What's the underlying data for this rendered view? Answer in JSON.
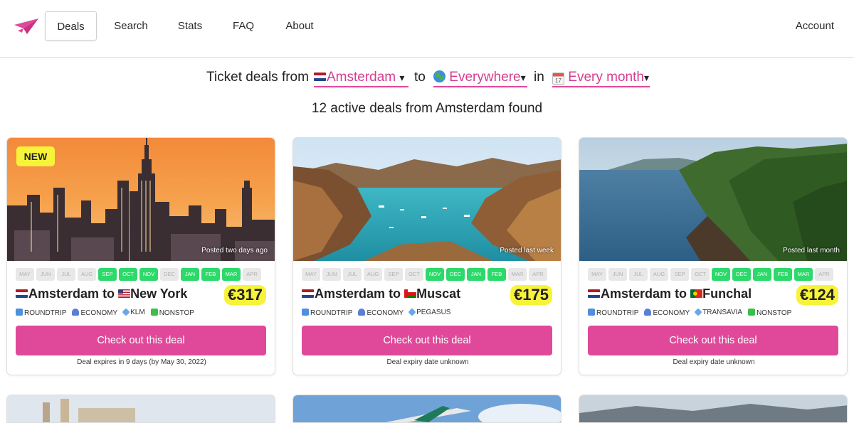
{
  "nav": {
    "items": [
      "Deals",
      "Search",
      "Stats",
      "FAQ",
      "About"
    ],
    "account": "Account"
  },
  "filters": {
    "prefix": "Ticket deals from",
    "from": "Amsterdam",
    "to_word": "to",
    "to": "Everywhere",
    "in_word": "in",
    "when": "Every month",
    "caret": "▾",
    "calendar_day": "17"
  },
  "results": {
    "summary": "12 active deals from Amsterdam found"
  },
  "month_labels": [
    "MAY",
    "JUN",
    "JUL",
    "AUG",
    "SEP",
    "OCT",
    "NOV",
    "DEC",
    "JAN",
    "FEB",
    "MAR",
    "APR"
  ],
  "deals": [
    {
      "badge": "NEW",
      "posted": "Posted two days ago",
      "from": "Amsterdam",
      "to_word": "to",
      "to": "New York",
      "price": "€317",
      "active_months": [
        false,
        false,
        false,
        false,
        true,
        true,
        true,
        false,
        true,
        true,
        true,
        false
      ],
      "tags": [
        "ROUNDTRIP",
        "ECONOMY",
        "KLM",
        "NONSTOP"
      ],
      "cta": "Check out this deal",
      "expiry": "Deal expires in 9 days (by May 30, 2022)"
    },
    {
      "badge": "",
      "posted": "Posted last week",
      "from": "Amsterdam",
      "to_word": "to",
      "to": "Muscat",
      "price": "€175",
      "active_months": [
        false,
        false,
        false,
        false,
        false,
        false,
        true,
        true,
        true,
        true,
        false,
        false
      ],
      "tags": [
        "ROUNDTRIP",
        "ECONOMY",
        "PEGASUS"
      ],
      "cta": "Check out this deal",
      "expiry": "Deal expiry date unknown"
    },
    {
      "badge": "",
      "posted": "Posted last month",
      "from": "Amsterdam",
      "to_word": "to",
      "to": "Funchal",
      "price": "€124",
      "active_months": [
        false,
        false,
        false,
        false,
        false,
        false,
        true,
        true,
        true,
        true,
        true,
        false
      ],
      "tags": [
        "ROUNDTRIP",
        "ECONOMY",
        "TRANSAVIA",
        "NONSTOP"
      ],
      "cta": "Check out this deal",
      "expiry": "Deal expiry date unknown"
    }
  ],
  "colors": {
    "accent": "#e0489a",
    "highlight": "#f7f23a",
    "month_on": "#2dd96a"
  }
}
